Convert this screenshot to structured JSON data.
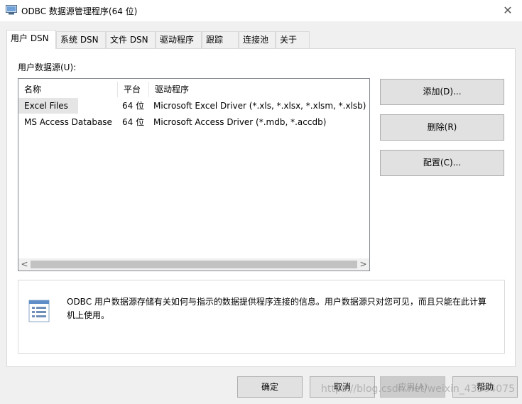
{
  "window": {
    "title": "ODBC 数据源管理程序(64 位)",
    "close_glyph": "✕"
  },
  "tabs": [
    {
      "label": "用户 DSN",
      "active": true
    },
    {
      "label": "系统 DSN"
    },
    {
      "label": "文件 DSN"
    },
    {
      "label": "驱动程序"
    },
    {
      "label": "跟踪"
    },
    {
      "label": "连接池"
    },
    {
      "label": "关于"
    }
  ],
  "datasources": {
    "label": "用户数据源(U):",
    "columns": [
      "名称",
      "平台",
      "驱动程序"
    ],
    "rows": [
      [
        "Excel Files",
        "64 位",
        "Microsoft Excel Driver (*.xls, *.xlsx, *.xlsm, *.xlsb)"
      ],
      [
        "MS Access Database",
        "64 位",
        "Microsoft Access Driver (*.mdb, *.accdb)"
      ]
    ],
    "scroll_left": "<",
    "scroll_right": ">"
  },
  "side_buttons": {
    "add": "添加(D)...",
    "remove": "删除(R)",
    "configure": "配置(C)..."
  },
  "info": {
    "text": "ODBC 用户数据源存储有关如何与指示的数据提供程序连接的信息。用户数据源只对您可见，而且只能在此计算机上使用。",
    "icon": "datasource-list-icon"
  },
  "bottom_buttons": {
    "ok": "确定",
    "cancel": "取消",
    "apply": "应用(A)",
    "help": "帮助"
  },
  "watermark": "https://blog.csdn.net/weixin_43304075",
  "colors": {
    "accent": "#0078d7",
    "selection": "#e5e5e5"
  }
}
